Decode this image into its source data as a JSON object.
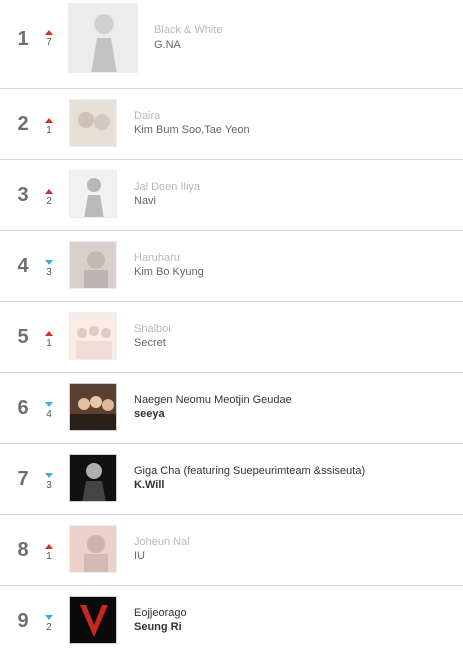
{
  "chart": {
    "entries": [
      {
        "rank": "1",
        "change": "7",
        "direction": "up",
        "title": "Black & White",
        "artist": "G.NA"
      },
      {
        "rank": "2",
        "change": "1",
        "direction": "up",
        "title": "Daira",
        "artist": "Kim Bum Soo,Tae Yeon"
      },
      {
        "rank": "3",
        "change": "2",
        "direction": "up",
        "title": "Jal Doen Iliya",
        "artist": "Navi"
      },
      {
        "rank": "4",
        "change": "3",
        "direction": "down",
        "title": "Haruharu",
        "artist": "Kim Bo Kyung"
      },
      {
        "rank": "5",
        "change": "1",
        "direction": "up",
        "title": "Shalboi",
        "artist": "Secret"
      },
      {
        "rank": "6",
        "change": "4",
        "direction": "down",
        "title": "Naegen Neomu Meotjin Geudae",
        "artist": "seeya"
      },
      {
        "rank": "7",
        "change": "3",
        "direction": "down",
        "title": "Giga Cha (featuring Suepeurimteam &ssiseuta)",
        "artist": "K.Will"
      },
      {
        "rank": "8",
        "change": "1",
        "direction": "up",
        "title": "Joheun Nal",
        "artist": "IU"
      },
      {
        "rank": "9",
        "change": "2",
        "direction": "down",
        "title": "Eojjeorago",
        "artist": "Seung Ri"
      }
    ]
  },
  "colors": {
    "up": "#d62b2b",
    "down": "#3aaee0",
    "title_faded": "#b8b8b8",
    "title_active": "#333333"
  }
}
